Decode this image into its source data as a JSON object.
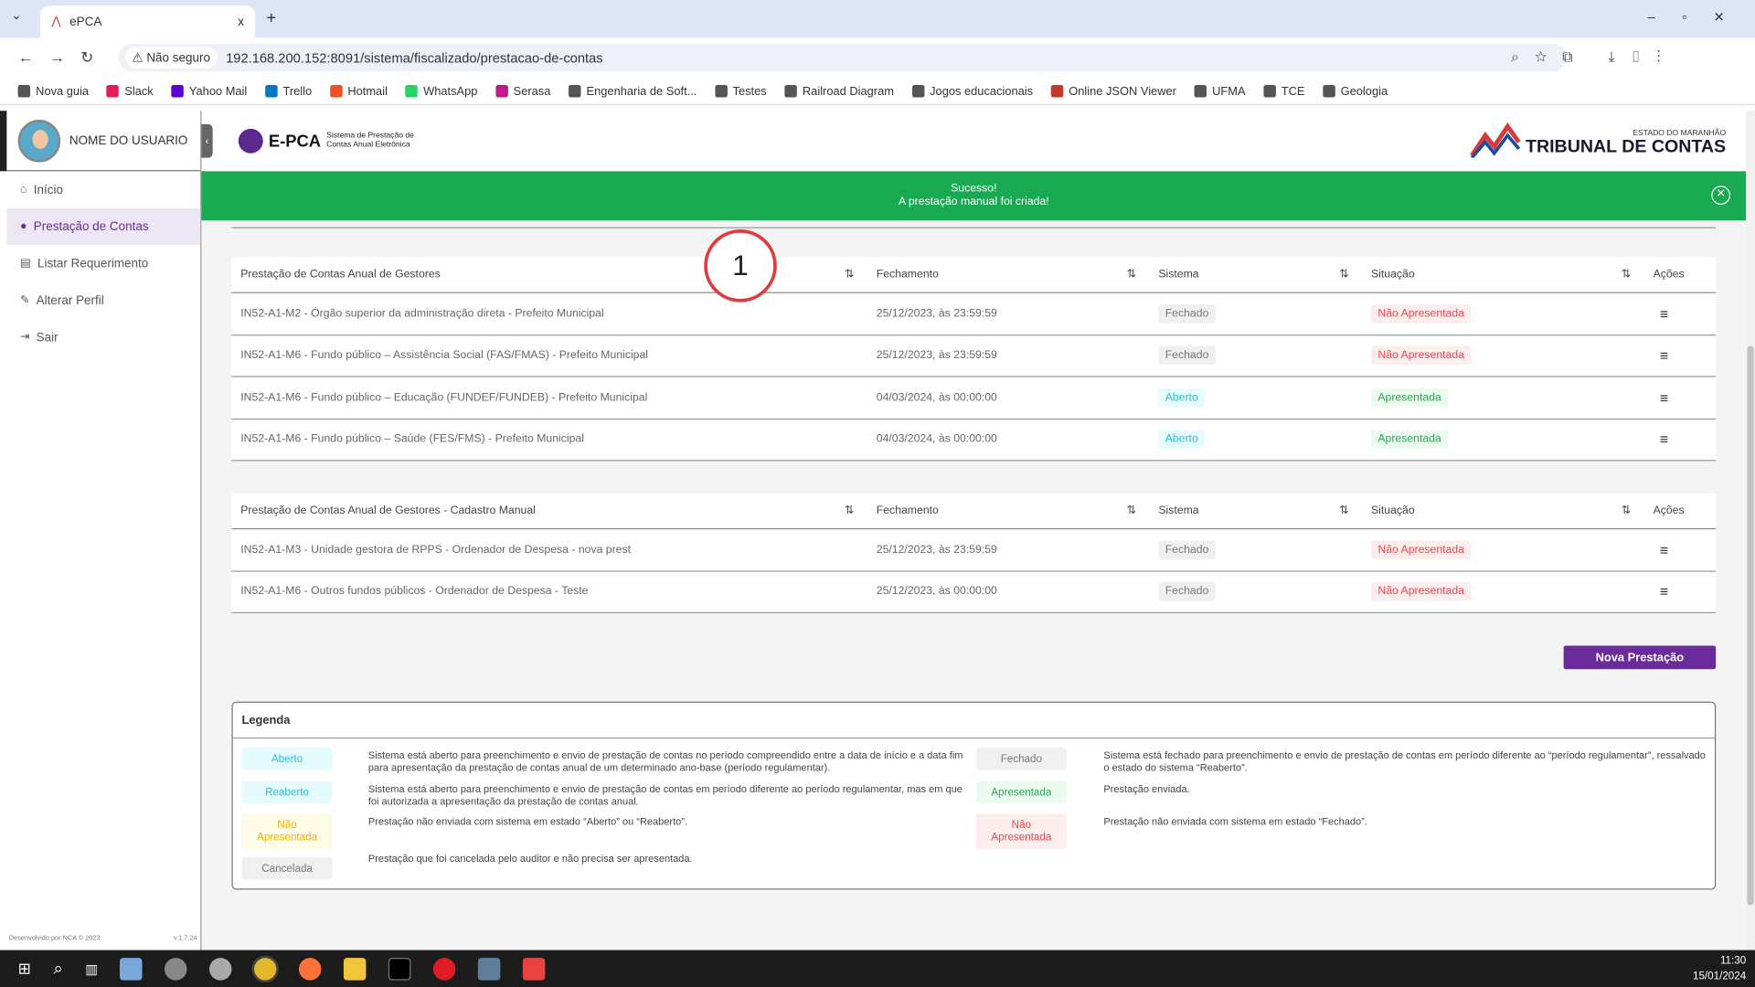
{
  "browser": {
    "tab_title": "ePCA",
    "new_tab": "+",
    "close": "x",
    "security": "Não seguro",
    "url": "192.168.200.152:8091/sistema/fiscalizado/prestacao-de-contas",
    "bookmarks": [
      {
        "label": "Nova guia",
        "color": "#555"
      },
      {
        "label": "Slack",
        "color": "#e01e5a"
      },
      {
        "label": "Yahoo Mail",
        "color": "#6001d2"
      },
      {
        "label": "Trello",
        "color": "#0079bf"
      },
      {
        "label": "Hotmail",
        "color": "#f25022"
      },
      {
        "label": "WhatsApp",
        "color": "#25d366"
      },
      {
        "label": "Serasa",
        "color": "#c1188b"
      },
      {
        "label": "Engenharia de Soft...",
        "color": "#555"
      },
      {
        "label": "Testes",
        "color": "#555"
      },
      {
        "label": "Railroad Diagram",
        "color": "#555"
      },
      {
        "label": "Jogos educacionais",
        "color": "#555"
      },
      {
        "label": "Online JSON Viewer",
        "color": "#c0392b"
      },
      {
        "label": "UFMA",
        "color": "#555"
      },
      {
        "label": "TCE",
        "color": "#555"
      },
      {
        "label": "Geologia",
        "color": "#555"
      }
    ]
  },
  "sidebar": {
    "user_name": "NOME DO USUARIO",
    "items": [
      {
        "label": "Início",
        "icon": "home-icon"
      },
      {
        "label": "Prestação de Contas",
        "icon": "user-icon",
        "active": true
      },
      {
        "label": "Listar Requerimento",
        "icon": "document-icon"
      },
      {
        "label": "Alterar Perfil",
        "icon": "user-edit-icon"
      },
      {
        "label": "Sair",
        "icon": "logout-icon"
      }
    ],
    "footer_left": "Desenvolvido por NCA © 2023",
    "version": "v.1.7.24"
  },
  "header": {
    "logo_text": "E-PCA",
    "logo_sub1": "Sistema de Prestação de",
    "logo_sub2": "Contas Anual Eletrônica",
    "tce_top": "ESTADO DO MARANHÃO",
    "tce_name": "TRIBUNAL DE CONTAS"
  },
  "banner": {
    "title": "Sucesso!",
    "message": "A prestação manual foi criada!",
    "color": "#1aa953"
  },
  "annotation": "1",
  "table1": {
    "headers": [
      "Prestação de Contas Anual de Gestores",
      "Fechamento",
      "Sistema",
      "Situação",
      "Ações"
    ],
    "rows": [
      {
        "name": "IN52-A1-M2 - Órgão superior da administração direta - Prefeito Municipal",
        "date": "25/12/2023, às 23:59:59",
        "sistema": "Fechado",
        "situacao": "Não Apresentada"
      },
      {
        "name": "IN52-A1-M6 - Fundo público – Assistência Social (FAS/FMAS) - Prefeito Municipal",
        "date": "25/12/2023, às 23:59:59",
        "sistema": "Fechado",
        "situacao": "Não Apresentada"
      },
      {
        "name": "IN52-A1-M6 - Fundo público – Educação (FUNDEF/FUNDEB) - Prefeito Municipal",
        "date": "04/03/2024, às 00:00:00",
        "sistema": "Aberto",
        "situacao": "Apresentada"
      },
      {
        "name": "IN52-A1-M6 - Fundo público – Saúde (FES/FMS) - Prefeito Municipal",
        "date": "04/03/2024, às 00:00:00",
        "sistema": "Aberto",
        "situacao": "Apresentada"
      }
    ]
  },
  "table2": {
    "headers": [
      "Prestação de Contas Anual de Gestores - Cadastro Manual",
      "Fechamento",
      "Sistema",
      "Situação",
      "Ações"
    ],
    "rows": [
      {
        "name": "IN52-A1-M3 - Unidade gestora de RPPS - Ordenador de Despesa - nova prest",
        "date": "25/12/2023, às 23:59:59",
        "sistema": "Fechado",
        "situacao": "Não Apresentada"
      },
      {
        "name": "IN52-A1-M6 - Outros fundos públicos - Ordenador de Despesa - Teste",
        "date": "25/12/2023, às 00:00:00",
        "sistema": "Fechado",
        "situacao": "Não Apresentada"
      }
    ]
  },
  "new_button": "Nova Prestação",
  "legend": {
    "title": "Legenda",
    "items": [
      {
        "badge": "Aberto",
        "text": "Sistema está aberto para preenchimento e envio de prestação de contas no período compreendido entre a data de início e a data fim para apresentação da prestação de contas anual de um determinado ano-base (período regulamentar)."
      },
      {
        "badge": "Reaberto",
        "text": "Sistema está aberto para preenchimento e envio de prestação de contas em período diferente ao período regulamentar, mas em que foi autorizada a apresentação da prestação de contas anual."
      },
      {
        "badge": "Não Apresentada",
        "text": "Prestação não enviada com sistema em estado “Aberto” ou “Reaberto”."
      },
      {
        "badge": "Cancelada",
        "text": "Prestação que foi cancelada pelo auditor e não precisa ser apresentada."
      },
      {
        "badge": "Fechado",
        "text": "Sistema está fechado para preenchimento e envio de prestação de contas em período diferente ao “período regulamentar”, ressalvado o estado do sistema “Reaberto”."
      },
      {
        "badge": "Apresentada",
        "text": "Prestação enviada."
      },
      {
        "badge": "Não Apresentada",
        "text": "Prestação não enviada com sistema em estado “Fechado”."
      }
    ]
  },
  "taskbar": {
    "time": "11:30",
    "date": "15/01/2024"
  }
}
